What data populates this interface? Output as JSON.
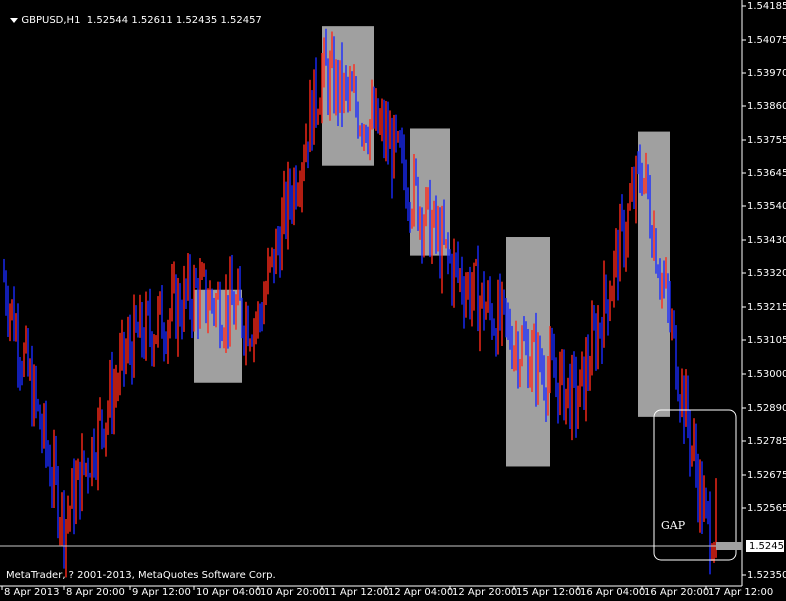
{
  "window": {
    "symbol": "GBPUSD,H1",
    "ohlc": [
      "1.52544",
      "1.52611",
      "1.52435",
      "1.52457"
    ]
  },
  "price_axis": {
    "labels": [
      "1.54185",
      "1.54075",
      "1.53970",
      "1.53860",
      "1.53755",
      "1.53645",
      "1.53540",
      "1.53430",
      "1.53320",
      "1.53215",
      "1.53105",
      "1.53000",
      "1.52890",
      "1.52785",
      "1.52675",
      "1.52565",
      "1.52350"
    ],
    "current_price": "1.52457"
  },
  "time_axis": {
    "labels": [
      "8 Apr 2013",
      "8 Apr 20:00",
      "9 Apr 12:00",
      "10 Apr 04:00",
      "10 Apr 20:00",
      "11 Apr 12:00",
      "12 Apr 04:00",
      "12 Apr 20:00",
      "15 Apr 12:00",
      "16 Apr 04:00",
      "16 Apr 20:00",
      "17 Apr 12:00"
    ]
  },
  "copyright": "MetaTrader, ? 2001-2013, MetaQuotes Software Corp.",
  "annotation": {
    "label": "GAP"
  },
  "colors": {
    "background": "#000000",
    "bull": "#ff2a1a",
    "bear": "#1a2bff",
    "zone": "#a0a0a0",
    "text": "#ffffff"
  },
  "chart_data": {
    "type": "candlestick",
    "instrument": "GBPUSD",
    "timeframe": "H1",
    "ylim": [
      1.5235,
      1.5419
    ],
    "close_path": [
      {
        "t": "8 Apr 2013",
        "price": 1.5333
      },
      {
        "t": "8 Apr 20:00",
        "price": 1.5252
      },
      {
        "t": "9 Apr 12:00",
        "price": 1.5309
      },
      {
        "t": "10 Apr 04:00",
        "price": 1.5326
      },
      {
        "t": "10 Apr 20:00",
        "price": 1.5317
      },
      {
        "t": "11 Apr 12:00",
        "price": 1.5397
      },
      {
        "t": "12 Apr 04:00",
        "price": 1.5376
      },
      {
        "t": "12 Apr 20:00",
        "price": 1.5335
      },
      {
        "t": "15 Apr 12:00",
        "price": 1.5311
      },
      {
        "t": "16 Apr 04:00",
        "price": 1.5291
      },
      {
        "t": "16 Apr 20:00",
        "price": 1.5367
      },
      {
        "t": "17 Apr 12:00",
        "price": 1.5251
      }
    ],
    "zones": [
      {
        "from": "10 Apr 04:00",
        "to": "10 Apr 12:00",
        "high": 1.5327,
        "low": 1.5297
      },
      {
        "from": "11 Apr 12:00",
        "to": "11 Apr 21:00",
        "high": 1.5412,
        "low": 1.5367
      },
      {
        "from": "12 Apr 06:00",
        "to": "12 Apr 16:00",
        "high": 1.5379,
        "low": 1.5338
      },
      {
        "from": "15 Apr 06:00",
        "to": "15 Apr 17:00",
        "high": 1.5344,
        "low": 1.527
      },
      {
        "from": "16 Apr 15:00",
        "to": "16 Apr 23:00",
        "high": 1.5378,
        "low": 1.5286
      }
    ],
    "current_price": 1.52457,
    "last_bar": {
      "open": 1.52544,
      "high": 1.52611,
      "low": 1.52435,
      "close": 1.52457
    }
  }
}
